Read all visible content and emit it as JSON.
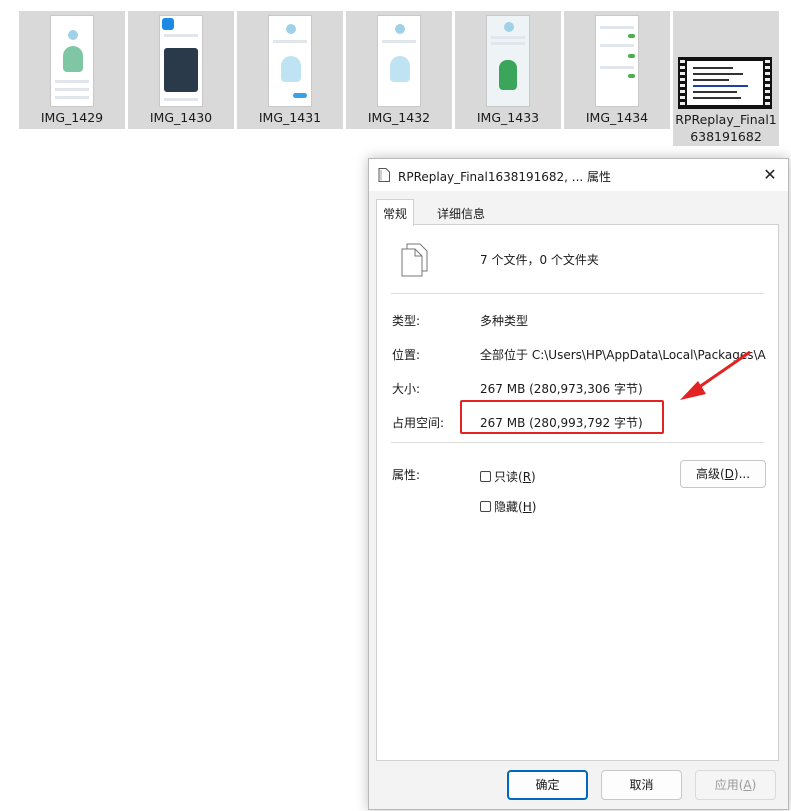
{
  "explorer": {
    "files": [
      {
        "name": "IMG_1429"
      },
      {
        "name": "IMG_1430"
      },
      {
        "name": "IMG_1431"
      },
      {
        "name": "IMG_1432"
      },
      {
        "name": "IMG_1433"
      },
      {
        "name": "IMG_1434"
      },
      {
        "name_line1": "RPReplay_Final1",
        "name_line2": "638191682"
      }
    ]
  },
  "dialog": {
    "title": "RPReplay_Final1638191682, ... 属性",
    "tabs": [
      {
        "label": "常规"
      },
      {
        "label": "详细信息"
      }
    ],
    "summary": "7 个文件，0 个文件夹",
    "type_label": "类型:",
    "type_value": "多种类型",
    "location_label": "位置:",
    "location_value": "全部位于 C:\\Users\\HP\\AppData\\Local\\Packages\\A",
    "size_label": "大小:",
    "size_value": "267 MB (280,973,306 字节)",
    "disk_size_label": "占用空间:",
    "disk_size_value": "267 MB (280,993,792 字节)",
    "attributes_label": "属性:",
    "readonly_label": "只读(",
    "readonly_key": "R",
    "readonly_end": ")",
    "hidden_label": "隐藏(",
    "hidden_key": "H",
    "hidden_end": ")",
    "advanced_label": "高级(",
    "advanced_key": "D",
    "advanced_end": ")...",
    "ok_label": "确定",
    "cancel_label": "取消",
    "apply_label": "应用(",
    "apply_key": "A",
    "apply_end": ")"
  },
  "colors": {
    "highlight": "#e32222",
    "accent": "#0067c0"
  }
}
